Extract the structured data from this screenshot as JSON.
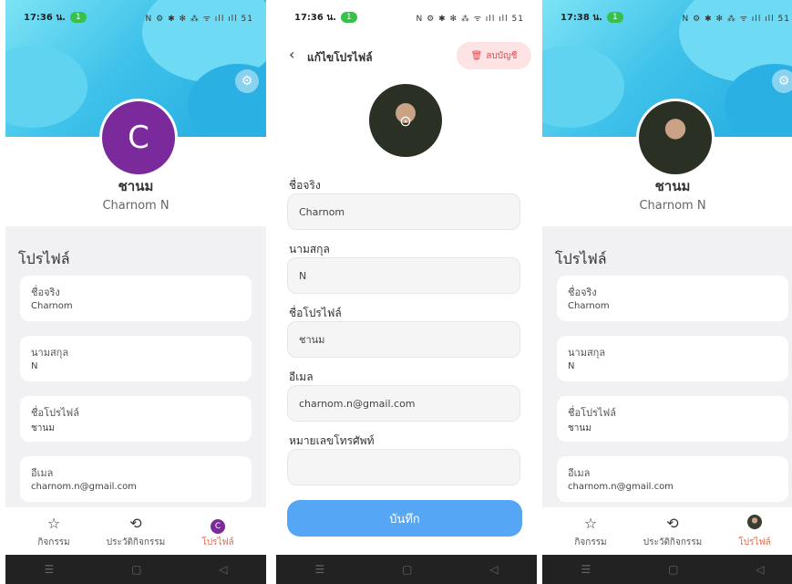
{
  "screens": [
    {
      "status": {
        "time": "17:36 น.",
        "pill": "1",
        "icons": "N ⚙ ✱ ✻ ⁂ ᯤ ıll ıll 51"
      },
      "username": "ชานม",
      "fullname": "Charnom N",
      "section": "โปรไฟล์",
      "avatar_letter": "C",
      "fields": [
        {
          "label": "ชื่อจริง",
          "value": "Charnom"
        },
        {
          "label": "นามสกุล",
          "value": "N"
        },
        {
          "label": "ชื่อโปรไฟล์",
          "value": "ชานม"
        },
        {
          "label": "อีเมล",
          "value": "charnom.n@gmail.com"
        }
      ],
      "nav": [
        "กิจกรรม",
        "ประวัติกิจกรรม",
        "โปรไฟล์"
      ]
    },
    {
      "status": {
        "time": "17:36 น.",
        "pill": "1",
        "icons": "N ⚙ ✱ ✻ ⁂ ᯤ ıll ıll 51"
      },
      "title": "แก้ไขโปรไฟล์",
      "delete_label": "ลบบัญชี",
      "fields": [
        {
          "label": "ชื่อจริง",
          "value": "Charnom"
        },
        {
          "label": "นามสกุล",
          "value": "N"
        },
        {
          "label": "ชื่อโปรไฟล์",
          "value": "ชานม"
        },
        {
          "label": "อีเมล",
          "value": "charnom.n@gmail.com"
        },
        {
          "label": "หมายเลขโทรศัพท์",
          "value": ""
        }
      ],
      "save_label": "บันทึก"
    },
    {
      "status": {
        "time": "17:38 น.",
        "pill": "1",
        "icons": "N ⚙ ✱ ✻ ⁂ ᯤ ıll ıll 51"
      },
      "username": "ชานม",
      "fullname": "Charnom N",
      "section": "โปรไฟล์",
      "fields": [
        {
          "label": "ชื่อจริง",
          "value": "Charnom"
        },
        {
          "label": "นามสกุล",
          "value": "N"
        },
        {
          "label": "ชื่อโปรไฟล์",
          "value": "ชานม"
        },
        {
          "label": "อีเมล",
          "value": "charnom.n@gmail.com"
        }
      ],
      "nav": [
        "กิจกรรม",
        "ประวัติกิจกรรม",
        "โปรไฟล์"
      ]
    }
  ],
  "icons": {
    "gear": "gear-icon",
    "star": "star-icon",
    "history": "history-icon",
    "trash": "trash-icon",
    "back": "chevron-left-icon",
    "camera": "camera-icon"
  },
  "colors": {
    "banner": "#3fc2ea",
    "avatar": "#7b2a9b",
    "active_nav": "#e8664a",
    "save": "#55a6f5",
    "delete_bg": "#fde3e3",
    "delete_text": "#e24b4b"
  }
}
